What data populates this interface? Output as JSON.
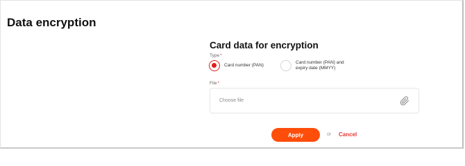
{
  "page": {
    "title": "Data encryption"
  },
  "form": {
    "section_title": "Card data for encryption",
    "type_field": {
      "label": "Type",
      "required_mark": "*",
      "options": [
        {
          "label": "Card number (PAN)",
          "selected": true
        },
        {
          "label": "Card number (PAN) and expiry date (MMYY)",
          "selected": false
        }
      ]
    },
    "file_field": {
      "label": "File",
      "required_mark": "*",
      "placeholder": "Choose file",
      "icon": "paperclip-icon"
    }
  },
  "actions": {
    "apply_label": "Apply",
    "separator": "or",
    "cancel_label": "Cancel"
  },
  "colors": {
    "accent": "#ff4d0a",
    "radio_selected": "#e11d1d",
    "cancel": "#e53935"
  }
}
